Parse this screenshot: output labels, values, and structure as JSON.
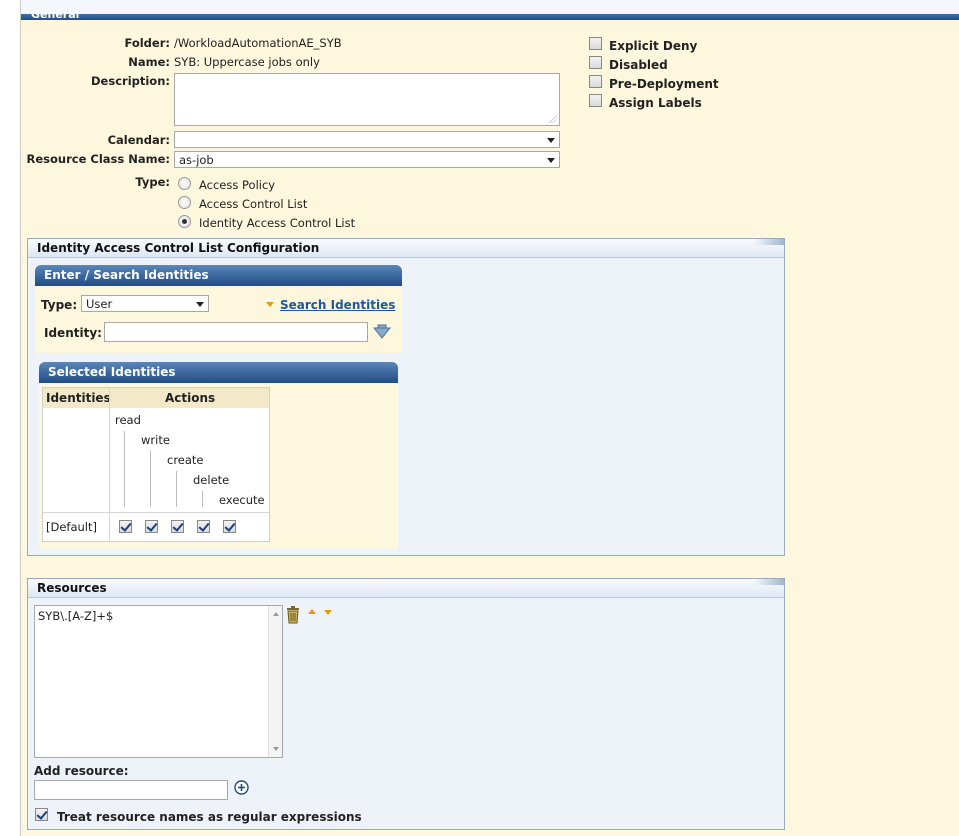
{
  "general": {
    "section_title": "General",
    "folder_label": "Folder:",
    "folder_value": "/WorkloadAutomationAE_SYB",
    "name_label": "Name:",
    "name_value": "SYB: Uppercase jobs only",
    "description_label": "Description:",
    "description_value": "",
    "calendar_label": "Calendar:",
    "calendar_value": "",
    "resource_class_label": "Resource Class Name:",
    "resource_class_value": "as-job",
    "type_label": "Type:",
    "type_options": [
      "Access Policy",
      "Access Control List",
      "Identity Access Control List"
    ],
    "type_selected": "Identity Access Control List",
    "flags": [
      {
        "label": "Explicit Deny",
        "checked": false
      },
      {
        "label": "Disabled",
        "checked": false
      },
      {
        "label": "Pre-Deployment",
        "checked": false
      },
      {
        "label": "Assign Labels",
        "checked": false
      }
    ]
  },
  "iacl": {
    "title": "Identity Access Control List Configuration",
    "enter_search": {
      "title": "Enter / Search Identities",
      "type_label": "Type:",
      "type_value": "User",
      "search_link": "Search Identities",
      "identity_label": "Identity:",
      "identity_value": ""
    },
    "selected": {
      "title": "Selected Identities",
      "col_identities": "Identities",
      "col_actions": "Actions",
      "actions": [
        "read",
        "write",
        "create",
        "delete",
        "execute"
      ],
      "rows": [
        {
          "identity": "[Default]",
          "checks": [
            true,
            true,
            true,
            true,
            true
          ]
        }
      ]
    }
  },
  "resources": {
    "title": "Resources",
    "items": [
      "SYB\\.[A-Z]+$"
    ],
    "add_label": "Add resource:",
    "add_value": "",
    "regex_label": "Treat resource names as regular expressions",
    "regex_checked": true
  },
  "colors": {
    "page_bg": "#fdf7dd",
    "panel_bg": "#eef3fa",
    "blue_header": "#1f4c86",
    "link": "#1f57a4"
  }
}
